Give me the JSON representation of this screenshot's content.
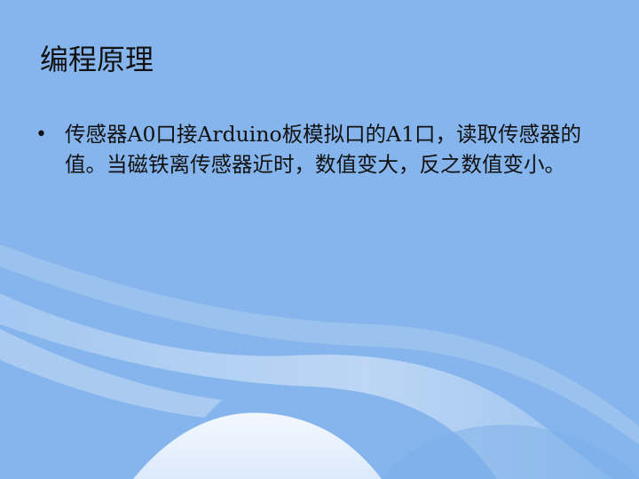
{
  "slide": {
    "title": "编程原理",
    "bullets": [
      {
        "text": "传感器A0口接Arduino板模拟口的A1口，读取传感器的值。当磁铁离传感器近时，数值变大，反之数值变小。"
      }
    ]
  },
  "colors": {
    "background": "#85b5ec",
    "wave_light": "#ffffff",
    "text": "#111111"
  }
}
